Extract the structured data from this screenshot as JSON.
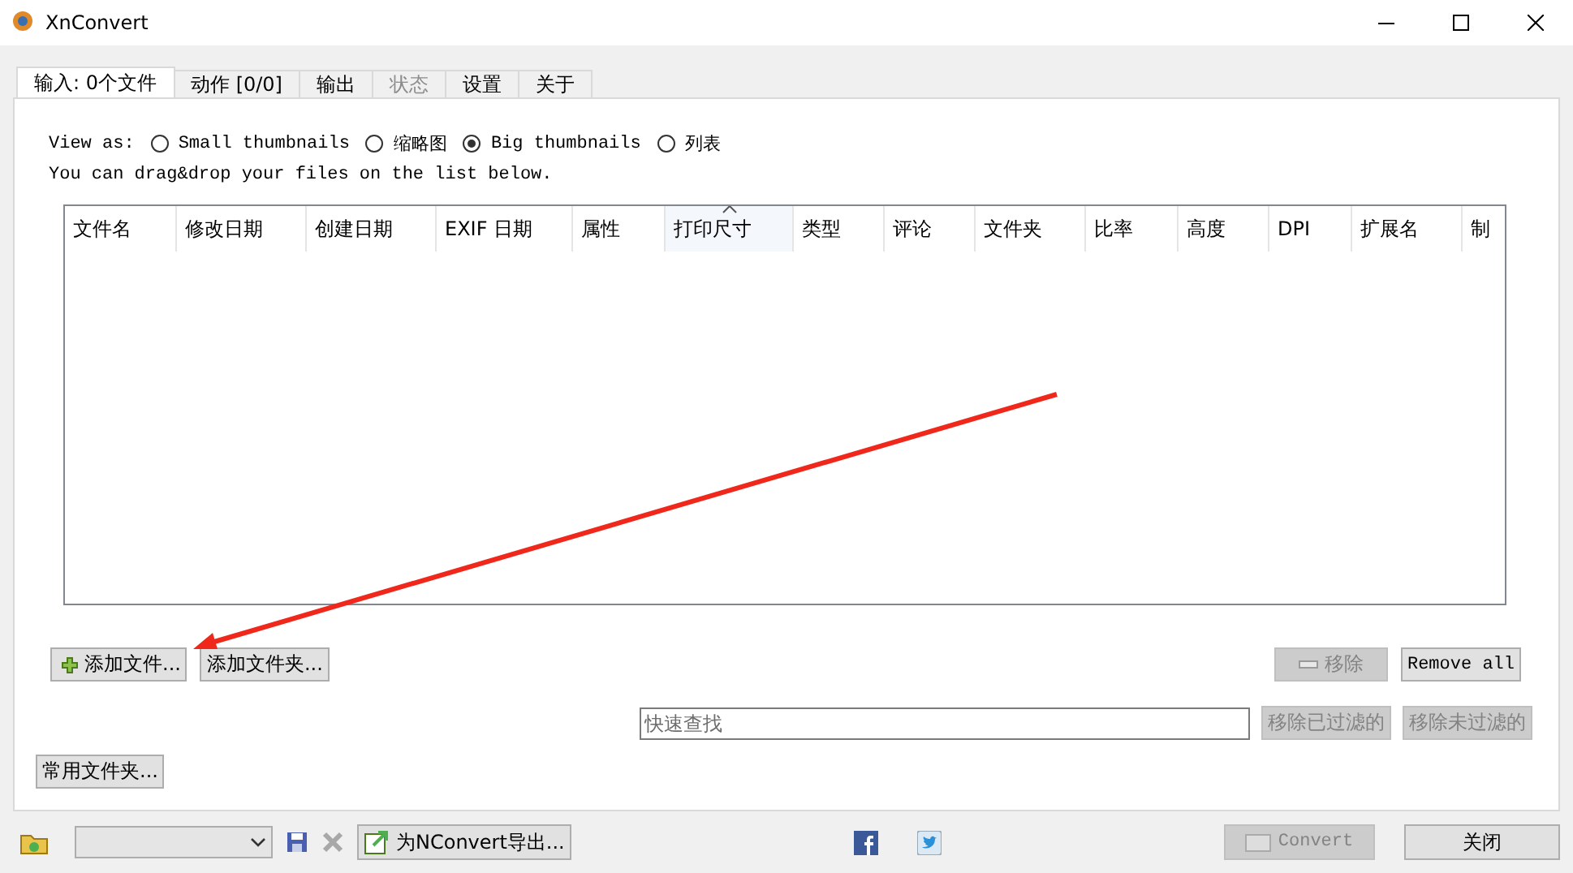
{
  "window": {
    "title": "XnConvert"
  },
  "tabs": [
    {
      "label": "输入: 0个文件",
      "selected": true,
      "disabled": false
    },
    {
      "label": "动作 [0/0]",
      "selected": false,
      "disabled": false
    },
    {
      "label": "输出",
      "selected": false,
      "disabled": false
    },
    {
      "label": "状态",
      "selected": false,
      "disabled": true
    },
    {
      "label": "设置",
      "selected": false,
      "disabled": false
    },
    {
      "label": "关于",
      "selected": false,
      "disabled": false
    }
  ],
  "view_as": {
    "label": "View as:",
    "options": [
      {
        "label": "Small thumbnails",
        "selected": false
      },
      {
        "label": "缩略图",
        "selected": false
      },
      {
        "label": "Big thumbnails",
        "selected": true
      },
      {
        "label": "列表",
        "selected": false
      }
    ]
  },
  "hint": "You can drag&drop your files on the list below.",
  "file_list": {
    "columns": [
      {
        "label": "文件名",
        "sorted": false
      },
      {
        "label": "修改日期",
        "sorted": false
      },
      {
        "label": "创建日期",
        "sorted": false
      },
      {
        "label": "EXIF 日期",
        "sorted": false
      },
      {
        "label": "属性",
        "sorted": false
      },
      {
        "label": "打印尺寸",
        "sorted": true
      },
      {
        "label": "类型",
        "sorted": false
      },
      {
        "label": "评论",
        "sorted": false
      },
      {
        "label": "文件夹",
        "sorted": false
      },
      {
        "label": "比率",
        "sorted": false
      },
      {
        "label": "高度",
        "sorted": false
      },
      {
        "label": "DPI",
        "sorted": false
      },
      {
        "label": "扩展名",
        "sorted": false
      },
      {
        "label": "制",
        "sorted": false
      }
    ]
  },
  "list_buttons": [
    {
      "label": "添加文件...",
      "kind": "add",
      "disabled": false
    },
    {
      "label": "添加文件夹...",
      "kind": "plain",
      "disabled": false
    },
    {
      "label": "移除",
      "kind": "remove",
      "disabled": true
    },
    {
      "label": "Remove all",
      "kind": "mono",
      "disabled": false
    }
  ],
  "quick_search": {
    "placeholder": "快速查找"
  },
  "filter_buttons": [
    {
      "label": "移除已过滤的",
      "disabled": true
    },
    {
      "label": "移除未过滤的",
      "disabled": true
    }
  ],
  "favorites_button": {
    "label": "常用文件夹..."
  },
  "footer": {
    "export_button": {
      "label": "为NConvert导出..."
    },
    "convert_button": {
      "label": "Convert",
      "disabled": true
    },
    "close_button": {
      "label": "关闭"
    }
  }
}
